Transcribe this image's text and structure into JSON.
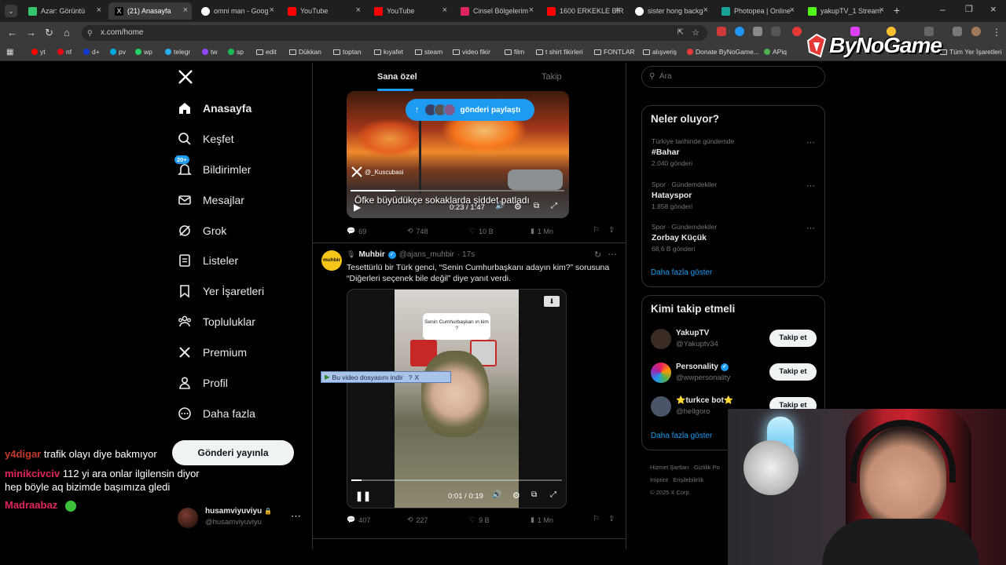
{
  "browser": {
    "tabs": [
      {
        "label": "Azar: Görüntü",
        "color": "#35c66b"
      },
      {
        "label": "(21) Anasayfa",
        "color": "#ffffff"
      },
      {
        "label": "omni man - Goog",
        "color": "#4285f4"
      },
      {
        "label": "YouTube",
        "color": "#ff0000"
      },
      {
        "label": "YouTube",
        "color": "#ff0000"
      },
      {
        "label": "Cinsel Bölgelerim",
        "color": "#e0245e"
      },
      {
        "label": "1600 ERKEKLE BİR",
        "color": "#ff0000"
      },
      {
        "label": "sister hong backg",
        "color": "#4285f4"
      },
      {
        "label": "Photopea | Online",
        "color": "#18a497"
      },
      {
        "label": "yakupTV_1 Stream",
        "color": "#53fc18"
      }
    ],
    "url": "x.com/home",
    "bookmarks": [
      "yt",
      "nf",
      "d+",
      "pv",
      "wp",
      "telegr",
      "tw",
      "sp",
      "edit",
      "Dükkan",
      "toptan",
      "kıyafet",
      "steam",
      "video fikir",
      "film",
      "t shirt fikirleri",
      "FONTLAR",
      "alışveriş",
      "Donate ByNoGame...",
      "APiq",
      "Tüm Yer İşaretleri"
    ],
    "brand_overlay": "ByNoGame"
  },
  "sidebar": {
    "items": [
      {
        "label": "Anasayfa",
        "icon": "home-icon"
      },
      {
        "label": "Keşfet",
        "icon": "search-icon"
      },
      {
        "label": "Bildirimler",
        "icon": "bell-icon"
      },
      {
        "label": "Mesajlar",
        "icon": "mail-icon"
      },
      {
        "label": "Grok",
        "icon": "grok-icon"
      },
      {
        "label": "Listeler",
        "icon": "list-icon"
      },
      {
        "label": "Yer İşaretleri",
        "icon": "bookmark-icon"
      },
      {
        "label": "Topluluklar",
        "icon": "people-icon"
      },
      {
        "label": "Premium",
        "icon": "x-icon"
      },
      {
        "label": "Profil",
        "icon": "person-icon"
      },
      {
        "label": "Daha fazla",
        "icon": "more-icon"
      }
    ],
    "notif_badge": "20+",
    "post_button": "Gönderi yayınla",
    "account": {
      "name": "husamviyuviyu",
      "handle": "@husamviyuviyu"
    }
  },
  "feed": {
    "tabs": [
      "Sana özel",
      "Takip"
    ],
    "new_posts_pill": "gönderi paylaştı",
    "post1": {
      "watermark": "@_Kuscubasi",
      "caption": "Öfke büyüdükçe sokaklarda şiddet patladı",
      "time": "0:23 / 1:47",
      "replies": "69",
      "reposts": "748",
      "likes": "10 B",
      "views": "1 Mn"
    },
    "post2": {
      "author": "Muhbir",
      "handle": "@ajans_muhbir",
      "age": "· 17s",
      "avatar_text": "muhbir",
      "text_line1": "Tesettürlü bir Türk genci, “Senin Cumhurbaşkanı adayın kim?” sorusuna",
      "text_line2": "“Diğerleri seçenek bile değil” diye yanıt verdi.",
      "video_card": "Senin Cumhurbaşkan ın kim ?",
      "download_overlay": "Bu video dosyasını indir",
      "time": "0:01 / 0:19",
      "replies": "407",
      "reposts": "227",
      "likes": "9 B",
      "views": "1 Mn"
    }
  },
  "right": {
    "search_placeholder": "Ara",
    "trends_title": "Neler oluyor?",
    "trends": [
      {
        "meta": "Türkiye tarihinde gündemde",
        "name": "#Bahar",
        "count": "2.040 gönderi"
      },
      {
        "meta": "Spor · Gündemdekiler",
        "name": "Hatayspor",
        "count": "1.858 gönderi"
      },
      {
        "meta": "Spor · Gündemdekiler",
        "name": "Zorbay Küçük",
        "count": "68,6 B gönderi"
      }
    ],
    "show_more": "Daha fazla göster",
    "follow_title": "Kimi takip etmeli",
    "who_to_follow": [
      {
        "name": "YakupTV",
        "handle": "@Yakuptv34"
      },
      {
        "name": "Personality",
        "handle": "@wwpersonality"
      },
      {
        "name": "⭐turkce bot⭐",
        "handle": "@hellgoro"
      }
    ],
    "follow_label": "Takip et",
    "footer": [
      "Hizmet Şartları",
      "Gizlilik Po",
      "İmprint",
      "Erişilebilirlik",
      "© 2025 X Corp."
    ]
  },
  "chat": [
    {
      "user": "y4digar",
      "msg": "trafik olayı diye bakmıyor",
      "color": "#c0392b"
    },
    {
      "user": "minikcivciv",
      "msg": "112 yi ara onlar ilgilensin diyor",
      "color": "#e0245e"
    },
    {
      "user": "",
      "msg": "hep böyle aq bizimde başımıza gledi",
      "color": "#ffffff"
    },
    {
      "user": "Madraabaz",
      "msg": "",
      "color": "#e0245e"
    }
  ]
}
